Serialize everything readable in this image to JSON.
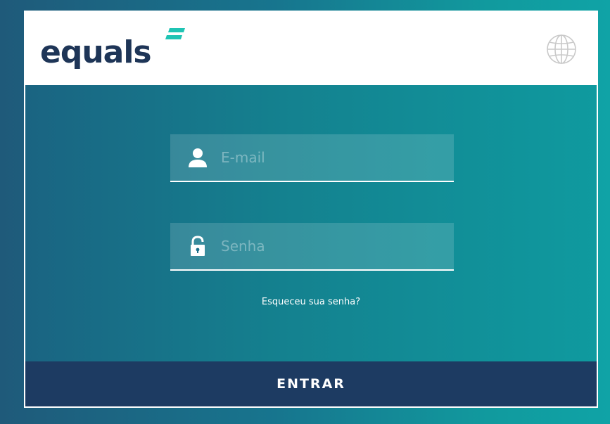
{
  "brand": {
    "logo_text": "equals",
    "logo_color": "#1e3557",
    "accent_color": "#1fc4b4"
  },
  "header": {
    "language_icon": "globe-icon"
  },
  "form": {
    "email": {
      "placeholder": "E-mail",
      "value": "",
      "icon": "user-icon"
    },
    "password": {
      "placeholder": "Senha",
      "value": "",
      "icon": "lock-icon"
    },
    "forgot_link": "Esqueceu sua senha?",
    "submit_label": "ENTRAR",
    "submit_color": "#1d3b62"
  }
}
